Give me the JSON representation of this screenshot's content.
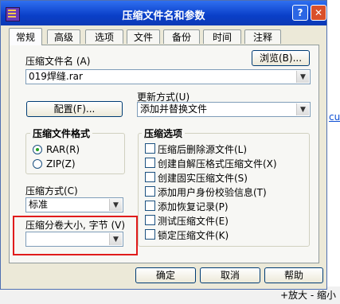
{
  "window": {
    "title": "压缩文件名和参数",
    "help_button": "?",
    "close_button": "✕"
  },
  "tabs": [
    {
      "label": "常规"
    },
    {
      "label": "高级"
    },
    {
      "label": "选项"
    },
    {
      "label": "文件"
    },
    {
      "label": "备份"
    },
    {
      "label": "时间"
    },
    {
      "label": "注释"
    }
  ],
  "general": {
    "archive_name_label": "压缩文件名 (A)",
    "archive_name_value": "019焊缝.rar",
    "browse_button": "浏览(B)...",
    "update_mode_label": "更新方式(U)",
    "update_mode_value": "添加并替换文件",
    "profiles_button": "配置(F)...",
    "format_group_title": "压缩文件格式",
    "format_options": [
      {
        "label": "RAR(R)",
        "selected": true
      },
      {
        "label": "ZIP(Z)",
        "selected": false
      }
    ],
    "method_label": "压缩方式(C)",
    "method_value": "标准",
    "volume_label": "压缩分卷大小, 字节 (V)",
    "volume_value": "",
    "options_group_title": "压缩选项",
    "options": [
      {
        "label": "压缩后删除源文件(L)",
        "checked": false
      },
      {
        "label": "创建自解压格式压缩文件(X)",
        "checked": false
      },
      {
        "label": "创建固实压缩文件(S)",
        "checked": false
      },
      {
        "label": "添加用户身份校验信息(T)",
        "checked": false
      },
      {
        "label": "添加恢复记录(P)",
        "checked": false
      },
      {
        "label": "测试压缩文件(E)",
        "checked": false
      },
      {
        "label": "锁定压缩文件(K)",
        "checked": false
      }
    ]
  },
  "buttons": {
    "ok": "确定",
    "cancel": "取消",
    "help": "帮助"
  },
  "background": {
    "fragment_1": "cu",
    "fragment_2": "+放大 - 缩小"
  },
  "colors": {
    "titlebar": "#0a3fc8",
    "dialog_bg": "#ece9d8",
    "highlight_box": "#e01b1b"
  }
}
